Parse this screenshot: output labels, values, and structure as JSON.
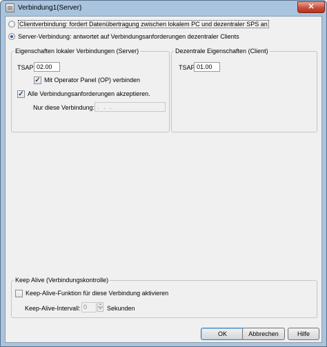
{
  "window": {
    "title": "Verbindung1(Server)",
    "close_glyph": "✕"
  },
  "mode": {
    "client_option": "Clientverbindung: fordert Datenübertragung zwischen lokalem PC und dezentraler SPS an",
    "server_option": "Server-Verbindung: antwortet auf Verbindungsanforderungen dezentraler Clients",
    "selected": "server"
  },
  "local_props": {
    "legend": "Eigenschaften lokaler Verbindungen (Server)",
    "tsap_label": "TSAP",
    "tsap_value": "02.00",
    "op_panel_label": "Mit Operator Panel (OP) verbinden",
    "op_panel_checked": true,
    "accept_all_label": "Alle Verbindungsanforderungen akzeptieren.",
    "accept_all_checked": true,
    "only_this_label": "Nur diese Verbindung:",
    "only_this_value": ". . ."
  },
  "remote_props": {
    "legend": "Dezentrale Eigenschaften (Client)",
    "tsap_label": "TSAP",
    "tsap_value": "01.00"
  },
  "keep_alive": {
    "legend": "Keep Alive (Verbindungskontrolle)",
    "enable_label": "Keep-Alive-Funktion für diese Verbindung aktivieren",
    "enable_checked": false,
    "interval_label": "Keep-Alive-Intervall:",
    "interval_value": "0",
    "unit": "Sekunden"
  },
  "buttons": {
    "ok": "OK",
    "cancel": "Abbrechen",
    "help": "Hilfe"
  }
}
